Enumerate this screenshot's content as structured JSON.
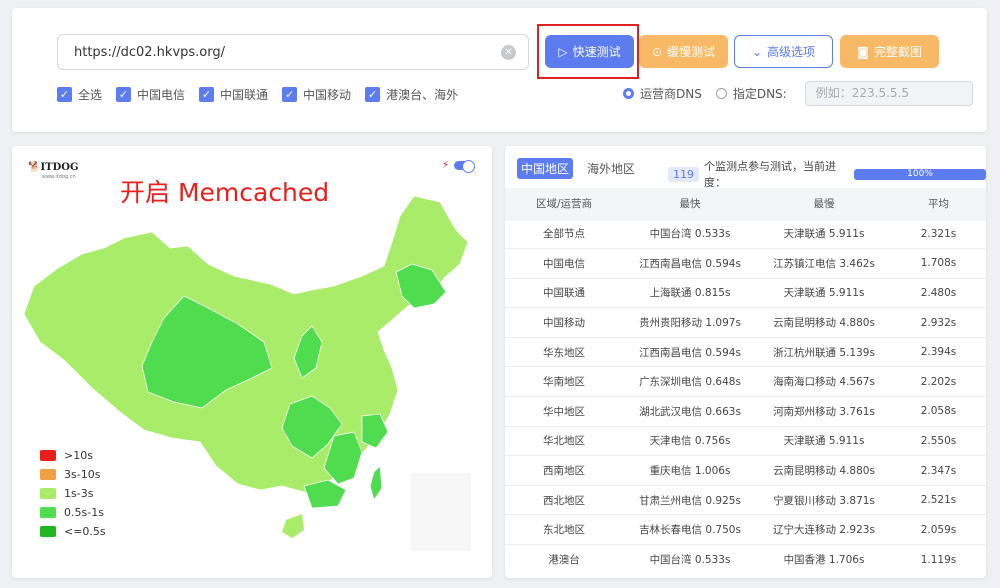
{
  "url": {
    "value": "https://dc02.hkvps.org/",
    "clear_icon": "close-circle-icon"
  },
  "buttons": {
    "fast": "快速测试",
    "slow": "缓慢测试",
    "advanced": "高级选项",
    "screenshot": "完整截图"
  },
  "checkboxes": [
    {
      "label": "全选",
      "checked": true
    },
    {
      "label": "中国电信",
      "checked": true
    },
    {
      "label": "中国联通",
      "checked": true
    },
    {
      "label": "中国移动",
      "checked": true
    },
    {
      "label": "港澳台、海外",
      "checked": true
    }
  ],
  "dns": {
    "option_isp": "运营商DNS",
    "option_custom": "指定DNS:",
    "placeholder": "例如：223.5.5.5",
    "selected": "运营商DNS"
  },
  "map": {
    "logo": "ITDOG",
    "logo_sub": "www.itdog.cn",
    "title": "开启 Memcached",
    "legend": [
      {
        "label": ">10s",
        "color": "#e8201c"
      },
      {
        "label": "3s-10s",
        "color": "#f0a040"
      },
      {
        "label": "1s-3s",
        "color": "#a8ec6a"
      },
      {
        "label": "0.5s-1s",
        "color": "#4fdc4f"
      },
      {
        "label": "<=0.5s",
        "color": "#22b522"
      }
    ],
    "colors": {
      "slow": "#a8ec6a",
      "medium": "#4fdc4f"
    }
  },
  "results": {
    "tabs": [
      "中国地区",
      "海外地区"
    ],
    "active_tab": "中国地区",
    "node_count": "119",
    "progress_text": "个监测点参与测试，当前进度：",
    "progress_value": "100%",
    "progress_fraction": 1.0,
    "headers": [
      "区域/运营商",
      "最快",
      "最慢",
      "平均"
    ],
    "rows": [
      [
        "全部节点",
        "中国台湾 0.533s",
        "天津联通 5.911s",
        "2.321s"
      ],
      [
        "中国电信",
        "江西南昌电信 0.594s",
        "江苏镇江电信 3.462s",
        "1.708s"
      ],
      [
        "中国联通",
        "上海联通 0.815s",
        "天津联通 5.911s",
        "2.480s"
      ],
      [
        "中国移动",
        "贵州贵阳移动 1.097s",
        "云南昆明移动 4.880s",
        "2.932s"
      ],
      [
        "华东地区",
        "江西南昌电信 0.594s",
        "浙江杭州联通 5.139s",
        "2.394s"
      ],
      [
        "华南地区",
        "广东深圳电信 0.648s",
        "海南海口移动 4.567s",
        "2.202s"
      ],
      [
        "华中地区",
        "湖北武汉电信 0.663s",
        "河南郑州移动 3.761s",
        "2.058s"
      ],
      [
        "华北地区",
        "天津电信 0.756s",
        "天津联通 5.911s",
        "2.550s"
      ],
      [
        "西南地区",
        "重庆电信 1.006s",
        "云南昆明移动 4.880s",
        "2.347s"
      ],
      [
        "西北地区",
        "甘肃兰州电信 0.925s",
        "宁夏银川移动 3.871s",
        "2.521s"
      ],
      [
        "东北地区",
        "吉林长春电信 0.750s",
        "辽宁大连移动 2.923s",
        "2.059s"
      ],
      [
        "港澳台",
        "中国台湾 0.533s",
        "中国香港 1.706s",
        "1.119s"
      ]
    ]
  }
}
